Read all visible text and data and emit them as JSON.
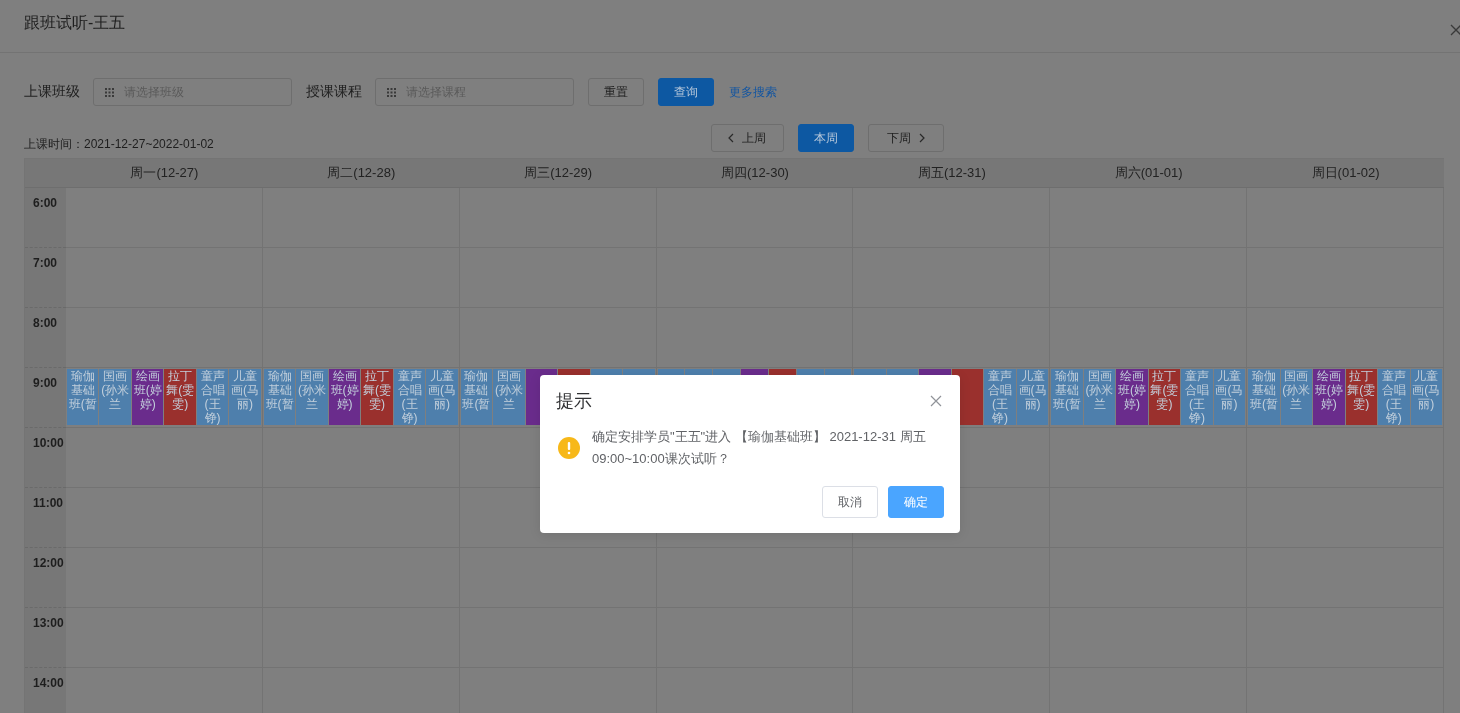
{
  "dialog_title": "跟班试听-王五",
  "filters": [
    {
      "label": "上课班级",
      "placeholder": "请选择班级"
    },
    {
      "label": "授课课程",
      "placeholder": "请选择课程"
    }
  ],
  "buttons": [
    {
      "label": "重置",
      "kind": "default"
    },
    {
      "label": "查询",
      "kind": "primary"
    },
    {
      "label": "更多搜索",
      "kind": "link"
    }
  ],
  "date_range": "上课时间：2021-12-27~2022-01-02",
  "week_nav": [
    {
      "label": "上周",
      "kind": "prev",
      "selected": false
    },
    {
      "label": "本周",
      "kind": "current",
      "selected": true
    },
    {
      "label": "下周",
      "kind": "next",
      "selected": false
    }
  ],
  "calendar": {
    "days": [
      "周一(12-27)",
      "周二(12-28)",
      "周三(12-29)",
      "周四(12-30)",
      "周五(12-31)",
      "周六(01-01)",
      "周日(01-02)"
    ],
    "rows": [
      {
        "time": "6:00"
      },
      {
        "time": "7:00"
      },
      {
        "time": "8:00"
      },
      {
        "time": "9:00",
        "cells": [
          [
            {
              "label": "瑜伽基础班(暂",
              "color": "#4e7fac"
            },
            {
              "label": "国画(孙米兰",
              "color": "#4e7fac"
            },
            {
              "label": "绘画班(婷婷)",
              "color": "#6a2c8c"
            },
            {
              "label": "拉丁舞(雯雯)",
              "color": "#9a302d"
            },
            {
              "label": "童声合唱(王铮)",
              "color": "#4e7fac"
            },
            {
              "label": "儿童画(马丽)",
              "color": "#4e7fac"
            }
          ],
          [
            {
              "label": "瑜伽基础班(暂",
              "color": "#4e7fac"
            },
            {
              "label": "国画(孙米兰",
              "color": "#4e7fac"
            },
            {
              "label": "绘画班(婷婷)",
              "color": "#6a2c8c"
            },
            {
              "label": "拉丁舞(雯雯)",
              "color": "#9a302d"
            },
            {
              "label": "童声合唱(王铮)",
              "color": "#4e7fac"
            },
            {
              "label": "儿童画(马丽)",
              "color": "#4e7fac"
            }
          ],
          [
            {
              "label": "瑜伽基础班(暂",
              "color": "#4e7fac"
            },
            {
              "label": "国画(孙米兰",
              "color": "#4e7fac"
            },
            {
              "color": "#6a2c8c"
            },
            {
              "color": "#9a302d"
            },
            {
              "color": "#4e7fac"
            },
            {
              "color": "#4e7fac"
            }
          ],
          [
            {
              "color": "#4e7fac"
            },
            {
              "color": "#4e7fac"
            },
            {
              "color": "#4e7fac"
            },
            {
              "color": "#6a2c8c"
            },
            {
              "color": "#9a302d"
            },
            {
              "color": "#4e7fac"
            },
            {
              "color": "#4e7fac"
            }
          ],
          [
            {
              "color": "#4e7fac"
            },
            {
              "color": "#4e7fac"
            },
            {
              "color": "#6a2c8c"
            },
            {
              "color": "#9a302d"
            },
            {
              "label": "童声合唱(王铮)",
              "color": "#4e7fac"
            },
            {
              "label": "儿童画(马丽)",
              "color": "#4e7fac"
            }
          ],
          [
            {
              "label": "瑜伽基础班(暂",
              "color": "#4e7fac"
            },
            {
              "label": "国画(孙米兰",
              "color": "#4e7fac"
            },
            {
              "label": "绘画班(婷婷)",
              "color": "#6a2c8c"
            },
            {
              "label": "拉丁舞(雯雯)",
              "color": "#9a302d"
            },
            {
              "label": "童声合唱(王铮)",
              "color": "#4e7fac"
            },
            {
              "label": "儿童画(马丽)",
              "color": "#4e7fac"
            }
          ],
          [
            {
              "label": "瑜伽基础班(暂",
              "color": "#4e7fac"
            },
            {
              "label": "国画(孙米兰",
              "color": "#4e7fac"
            },
            {
              "label": "绘画班(婷婷)",
              "color": "#6a2c8c"
            },
            {
              "label": "拉丁舞(雯雯)",
              "color": "#9a302d"
            },
            {
              "label": "童声合唱(王铮)",
              "color": "#4e7fac"
            },
            {
              "label": "儿童画(马丽)",
              "color": "#4e7fac"
            }
          ]
        ]
      },
      {
        "time": "10:00"
      },
      {
        "time": "11:00"
      },
      {
        "time": "12:00"
      },
      {
        "time": "13:00"
      },
      {
        "time": "14:00"
      }
    ]
  },
  "modal": {
    "title": "提示",
    "message": "确定安排学员\"王五\"进入 【瑜伽基础班】 2021-12-31 周五09:00~10:00课次试听？",
    "buttons": [
      {
        "label": "取消",
        "kind": "default"
      },
      {
        "label": "确定",
        "kind": "primary"
      }
    ]
  }
}
